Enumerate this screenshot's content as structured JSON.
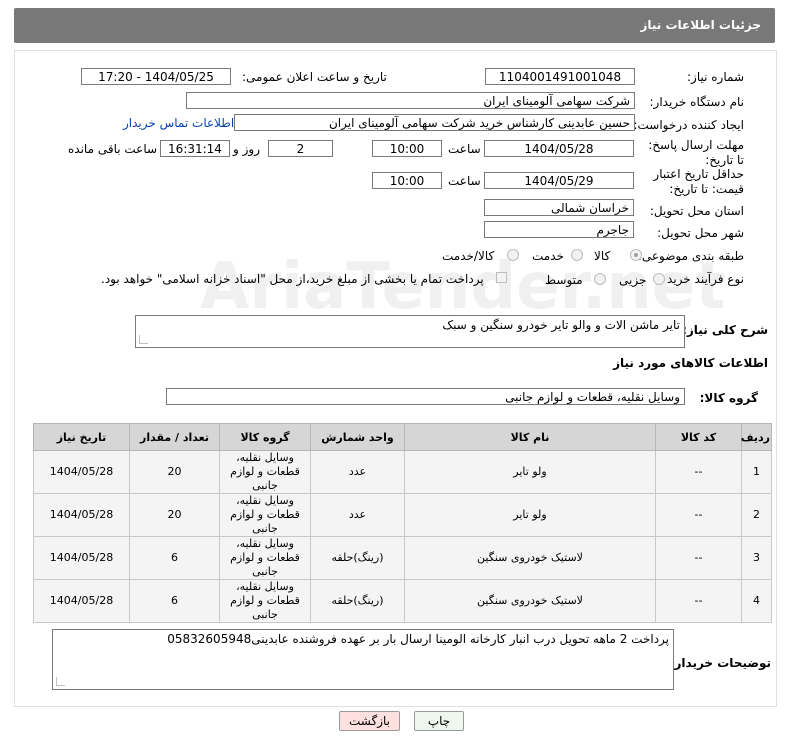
{
  "header": {
    "title": "جزئیات اطلاعات نیاز"
  },
  "form": {
    "need_number_label": "شماره نیاز:",
    "need_number": "1104001491001048",
    "announce_label": "تاریخ و ساعت اعلان عمومی:",
    "announce_value": "1404/05/25 - 17:20",
    "buyer_org_label": "نام دستگاه خریدار:",
    "buyer_org": "شرکت سهامی آلومینای ایران",
    "creator_label": "ایجاد کننده درخواست:",
    "creator": "حسین عابدینی کارشناس خرید شرکت سهامی آلومینای ایران",
    "contact_link": "اطلاعات تماس خریدار",
    "deadline_label": "مهلت ارسال پاسخ: تا تاریخ:",
    "deadline_date": "1404/05/28",
    "time_label": "ساعت",
    "deadline_time": "10:00",
    "days_value": "2",
    "days_label": "روز و",
    "remaining_time": "16:31:14",
    "remaining_label": "ساعت باقی مانده",
    "price_validity_label": "حداقل تاریخ اعتبار قیمت: تا تاریخ:",
    "price_date": "1404/05/29",
    "price_time": "10:00",
    "province_label": "استان محل تحویل:",
    "province": "خراسان شمالی",
    "city_label": "شهر محل تحویل:",
    "city": "جاجرم",
    "category_label": "طبقه بندی موضوعی:",
    "category_options": [
      "کالا",
      "خدمت",
      "کالا/خدمت"
    ],
    "purchase_type_label": "نوع فرآیند خرید :",
    "purchase_options": [
      "جزیی",
      "متوسط"
    ],
    "payment_note": "پرداخت تمام یا بخشی از مبلغ خرید،از محل \"اسناد خزانه اسلامی\" خواهد بود.",
    "description_label": "شرح کلی نیاز:",
    "description": "تایر ماشن الات و والو تایر خودرو سنگین و سبک",
    "goods_info_title": "اطلاعات کالاهای مورد نیاز",
    "goods_group_label": "گروه کالا:",
    "goods_group": "وسایل نقلیه، قطعات و لوازم جانبی"
  },
  "table": {
    "headers": [
      "ردیف",
      "کد کالا",
      "نام کالا",
      "واحد شمارش",
      "گروه کالا",
      "تعداد / مقدار",
      "تاریخ نیاز"
    ],
    "rows": [
      {
        "row": "1",
        "code": "--",
        "name": "ولو تایر",
        "unit": "عدد",
        "group": "وسایل نقلیه، قطعات و لوازم جانبی",
        "qty": "20",
        "date": "1404/05/28"
      },
      {
        "row": "2",
        "code": "--",
        "name": "ولو تایر",
        "unit": "عدد",
        "group": "وسایل نقلیه، قطعات و لوازم جانبی",
        "qty": "20",
        "date": "1404/05/28"
      },
      {
        "row": "3",
        "code": "--",
        "name": "لاستیک خودروی سنگین",
        "unit": "(رینگ)حلقه",
        "group": "وسایل نقلیه، قطعات و لوازم جانبی",
        "qty": "6",
        "date": "1404/05/28"
      },
      {
        "row": "4",
        "code": "--",
        "name": "لاستیک خودروی سنگین",
        "unit": "(رینگ)حلقه",
        "group": "وسایل نقلیه، قطعات و لوازم جانبی",
        "qty": "6",
        "date": "1404/05/28"
      }
    ]
  },
  "buyer_notes_label": "توضیحات خریدار:",
  "buyer_notes": "پرداخت 2 ماهه تحویل درب انبار کارخانه الومینا ارسال بار بر عهده فروشنده عابدینی05832605948",
  "buttons": {
    "print": "چاپ",
    "back": "بازگشت"
  },
  "watermark": "AriaTender.net",
  "colors": {
    "header_bg": "#787878",
    "back_button_bg": "#fde0e0",
    "print_button_bg": "#eef8ee"
  }
}
